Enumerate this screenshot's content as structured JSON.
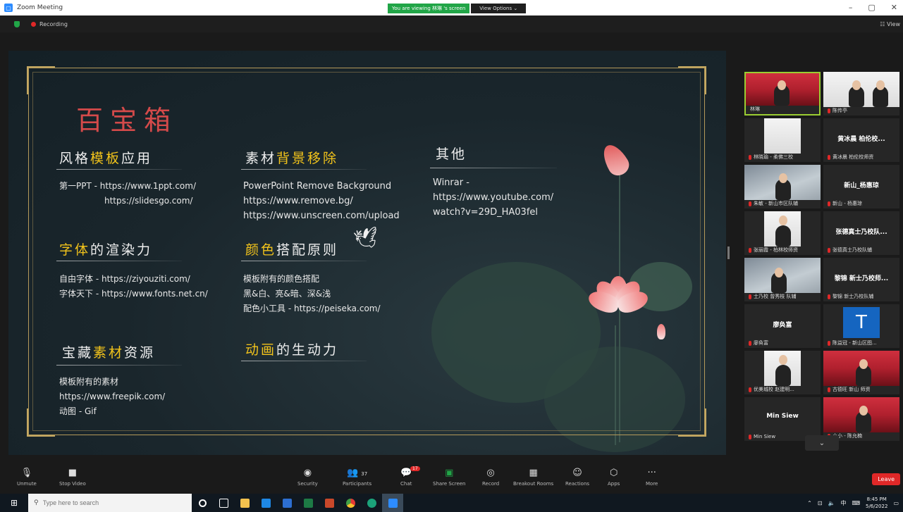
{
  "window": {
    "title": "Zoom Meeting",
    "share_status": "You are viewing 林琳 's screen",
    "view_options": "View Options",
    "minimize": "–",
    "restore": "▢",
    "close": "✕"
  },
  "infobar": {
    "recording": "Recording",
    "view": "View"
  },
  "slide": {
    "title": "百宝箱",
    "sections": [
      {
        "pre": "风格",
        "hl": "模板",
        "post": "应用",
        "lines": [
          "第一PPT - https://www.1ppt.com/",
          "            https://slidesgo.com/"
        ]
      },
      {
        "pre": "素材",
        "hl": "背景移除",
        "post": "",
        "lines": [
          "PowerPoint Remove Background",
          "https://www.remove.bg/",
          "https://www.unscreen.com/upload"
        ]
      },
      {
        "pre": "其他",
        "hl": "",
        "post": "",
        "lines": [
          "Winrar -",
          "https://www.youtube.com/",
          "watch?v=29D_HA03fel"
        ]
      },
      {
        "pre": "",
        "hl": "字体",
        "post": "的渲染力",
        "lines": [
          "自由字体 - https://ziyouziti.com/",
          "字体天下 - https://www.fonts.net.cn/"
        ]
      },
      {
        "pre": "",
        "hl": "颜色",
        "post": "搭配原则",
        "lines": [
          "模板附有的颜色搭配",
          "黑&白、亮&暗、深&浅",
          "配色小工具 - https://peiseka.com/"
        ]
      },
      {
        "pre": "宝藏",
        "hl": "素材",
        "post": "资源",
        "lines": [
          "模板附有的素材",
          "https://www.freepik.com/",
          "动图 - Gif"
        ]
      },
      {
        "pre": "",
        "hl": "动画",
        "post": "的生动力",
        "lines": []
      }
    ]
  },
  "gallery": {
    "tiles": [
      {
        "name": "林琳",
        "center": ""
      },
      {
        "name": "陈传亭",
        "center": ""
      },
      {
        "name": "林晓瑜 - 柔佛三校",
        "center": ""
      },
      {
        "name": "黄冰晨 柏伦校师资",
        "center": "黄冰晨 柏伦校..."
      },
      {
        "name": "朱敏 - 新山市区队辅",
        "center": ""
      },
      {
        "name": "新山 - 杨惠琼",
        "center": "新山_杨惠琼"
      },
      {
        "name": "张丽霞 - 柏林校师资",
        "center": ""
      },
      {
        "name": "张德真士乃校队辅",
        "center": "张德真士乃校队..."
      },
      {
        "name": "士乃校 曾秀枝 队辅",
        "center": ""
      },
      {
        "name": "黎锦 新士乃校队辅",
        "center": "黎锦 新士乃校师..."
      },
      {
        "name": "廖奂富",
        "center": "廖奂富"
      },
      {
        "name": "陈益冠 - 新山区图...",
        "center": ""
      },
      {
        "name": "优美城校 赵建明...",
        "center": ""
      },
      {
        "name": "古德旺 新山 师资",
        "center": ""
      },
      {
        "name": "Min Siew",
        "center": "Min Siew"
      },
      {
        "name": "小小 - 陈允楠",
        "center": ""
      }
    ],
    "avatar_letter": "T",
    "scroll_down": "⌄"
  },
  "toolbar": {
    "unmute": "Unmute",
    "stop_video": "Stop Video",
    "security": "Security",
    "participants": "Participants",
    "participants_count": "37",
    "chat": "Chat",
    "chat_badge": "17",
    "share_screen": "Share Screen",
    "record": "Record",
    "breakout_rooms": "Breakout Rooms",
    "reactions": "Reactions",
    "apps": "Apps",
    "more": "More",
    "leave": "Leave"
  },
  "taskbar": {
    "search_placeholder": "Type here to search",
    "time": "8:45 PM",
    "date": "5/6/2022",
    "ime": "中"
  }
}
